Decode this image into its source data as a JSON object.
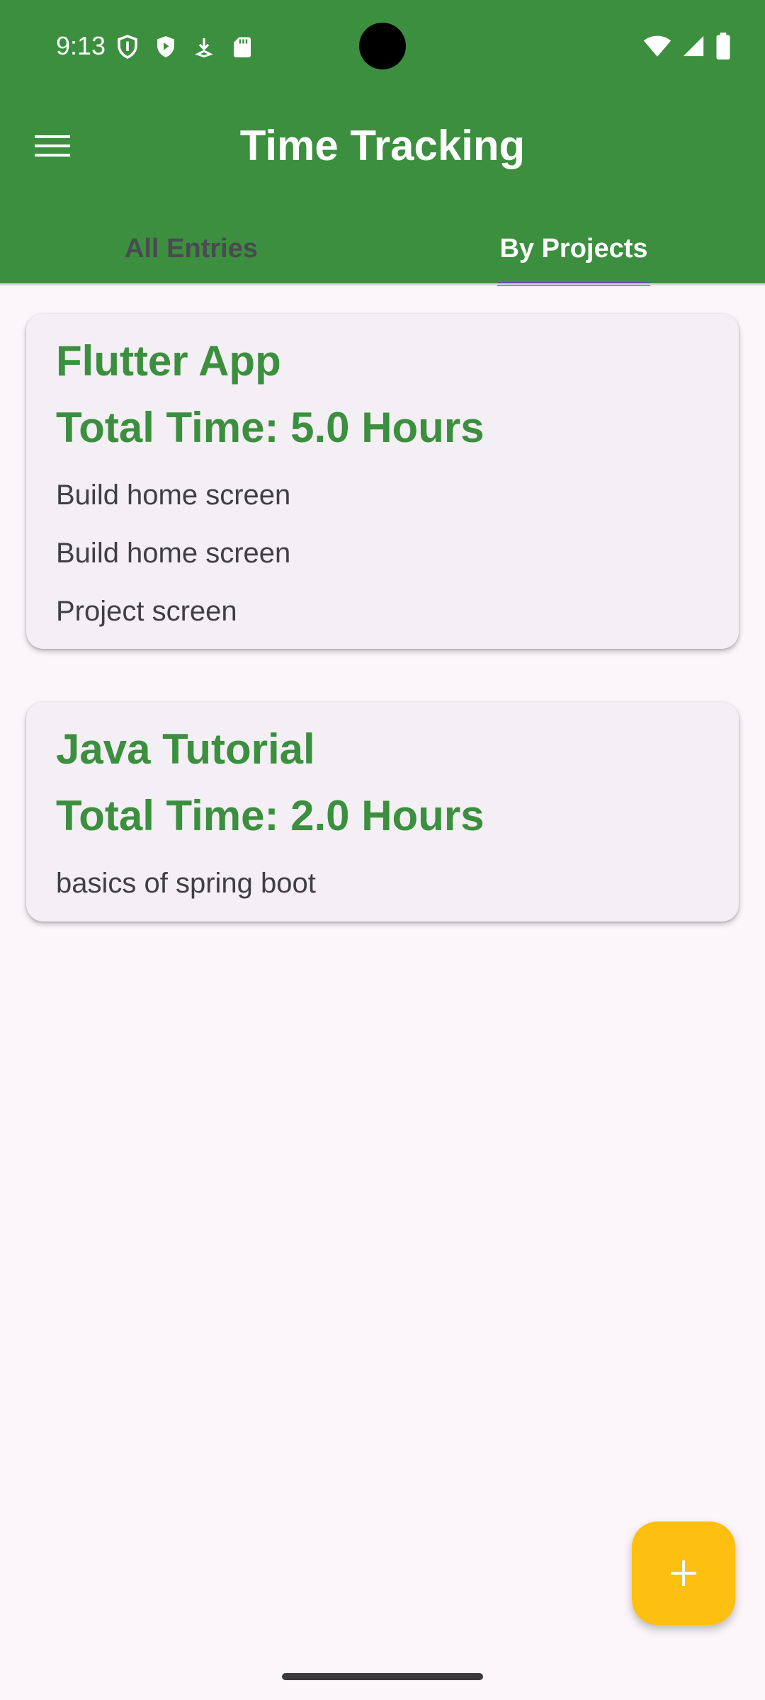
{
  "status_bar": {
    "time": "9:13",
    "icons": [
      "shield-outline-icon",
      "play-shield-icon",
      "download-icon",
      "sd-card-icon",
      "wifi-icon",
      "signal-icon",
      "battery-icon"
    ]
  },
  "app_bar": {
    "title": "Time Tracking",
    "menu_icon": "hamburger-menu-icon",
    "color": "#3b8f3e"
  },
  "tabs": [
    {
      "label": "All Entries",
      "selected": false
    },
    {
      "label": "By Projects",
      "selected": true
    }
  ],
  "projects": [
    {
      "name": "Flutter App",
      "total": "Total Time: 5.0 Hours",
      "entries": [
        "Build home screen",
        "Build home screen",
        "Project screen"
      ]
    },
    {
      "name": "Java Tutorial",
      "total": "Total Time: 2.0 Hours",
      "entries": [
        "basics of spring boot"
      ]
    }
  ],
  "fab": {
    "icon": "plus-icon",
    "color": "#fec010"
  },
  "colors": {
    "accent": "#3b8f3e",
    "tab_indicator": "#6550a6",
    "background": "#fcf6fb"
  }
}
